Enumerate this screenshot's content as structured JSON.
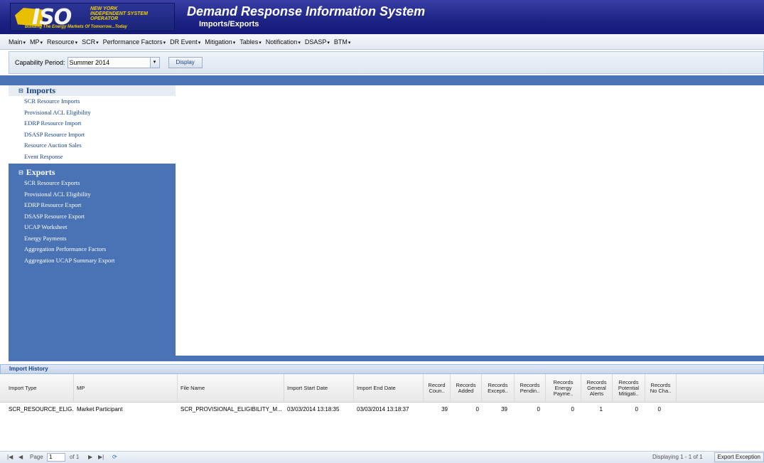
{
  "header": {
    "logo_iso": "ISO",
    "logo_org": "New York Independent System Operator",
    "logo_tagline": "Building The Energy Markets Of Tomorrow...Today",
    "title": "Demand Response Information System",
    "subtitle": "Imports/Exports"
  },
  "menu": [
    {
      "label": "Main"
    },
    {
      "label": "MP"
    },
    {
      "label": "Resource"
    },
    {
      "label": "SCR"
    },
    {
      "label": "Performance Factors"
    },
    {
      "label": "DR Event"
    },
    {
      "label": "Mitigation"
    },
    {
      "label": "Tables"
    },
    {
      "label": "Notification"
    },
    {
      "label": "DSASP"
    },
    {
      "label": "BTM"
    }
  ],
  "toolbar": {
    "capability_label": "Capability Period:",
    "capability_value": "Summer 2014",
    "display_button": "Display"
  },
  "sidebar": {
    "imports": {
      "title": "Imports",
      "toggle": "⊟",
      "items": [
        "SCR Resource Imports",
        "Provisional ACL Eligibility",
        "EDRP Resource Import",
        "DSASP Resource Import",
        "Resource Auction Sales",
        "Event Response"
      ]
    },
    "exports": {
      "title": "Exports",
      "toggle": "⊟",
      "items": [
        "SCR Resource Exports",
        "Provisional ACL Eligibility",
        "EDRP Resource Export",
        "DSASP Resource Export",
        "UCAP Worksheet",
        "Energy Payments",
        "Aggregation Performance Factors",
        "Aggregation UCAP Summary Export"
      ]
    }
  },
  "grid": {
    "title": "Import History",
    "columns": [
      "Import Type",
      "MP",
      "File Name",
      "Import Start Date",
      "Import End Date",
      "Record Coun..",
      "Records Added",
      "Records Excepti..",
      "Records Pendin..",
      "Records Energy Payme..",
      "Records General Alerts",
      "Records Potential Mitigati..",
      "Records No Cha.."
    ],
    "rows": [
      [
        "SCR_RESOURCE_ELIG...",
        "Market Participant",
        "SCR_PROVISIONAL_ELIGIBILITY_M...",
        "03/03/2014 13:18:35",
        "03/03/2014 13:18:37",
        "39",
        "0",
        "39",
        "0",
        "0",
        "1",
        "0",
        "0"
      ]
    ],
    "footer": {
      "page_label": "Page",
      "page_value": "1",
      "of_label": "of 1",
      "displaying": "Displaying 1 - 1 of 1",
      "export_button": "Export Exception"
    }
  },
  "colors": {
    "header": "#1d2384",
    "sidebar": "#4a73b5",
    "link": "#15428b"
  }
}
